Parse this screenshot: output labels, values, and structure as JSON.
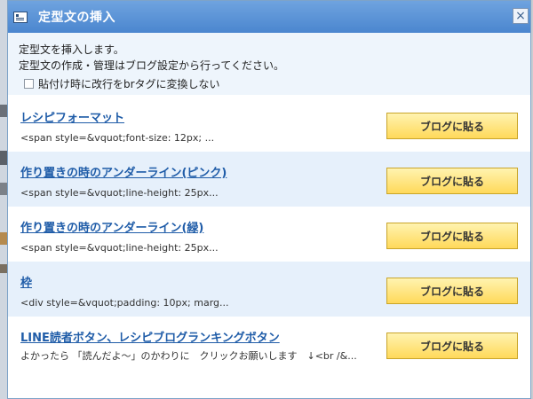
{
  "dialog": {
    "title": "定型文の挿入",
    "close_glyph": "×",
    "intro": {
      "line1": "定型文を挿入します。",
      "line2": "定型文の作成・管理はブログ設定から行ってください。",
      "checkbox_label": "貼付け時に改行をbrタグに変換しない",
      "checkbox_checked": false
    },
    "templates": [
      {
        "title": "レシピフォーマット",
        "snippet": "<span style=&vquot;font-size: 12px; ...",
        "button": "ブログに貼る"
      },
      {
        "title": "作り置きの時のアンダーライン(ピンク)",
        "snippet": "<span style=&vquot;line-height: 25px...",
        "button": "ブログに貼る"
      },
      {
        "title": "作り置きの時のアンダーライン(緑)",
        "snippet": "<span style=&vquot;line-height: 25px...",
        "button": "ブログに貼る"
      },
      {
        "title": "枠",
        "snippet": "<div style=&vquot;padding: 10px; marg...",
        "button": "ブログに貼る"
      },
      {
        "title": "LINE読者ボタン、レシピブログランキングボタン",
        "snippet": "よかったら 「読んだよ〜」のかわりに　クリックお願いします　↓<br /&...",
        "button": "ブログに貼る"
      }
    ]
  },
  "colors": {
    "titlebar": "#4b86cf",
    "link": "#1f5ca8",
    "button": "#ffd95a",
    "alt_row": "#e6f0fb"
  },
  "icons": {
    "title_icon": "dialog-window-icon",
    "close": "close-icon"
  }
}
